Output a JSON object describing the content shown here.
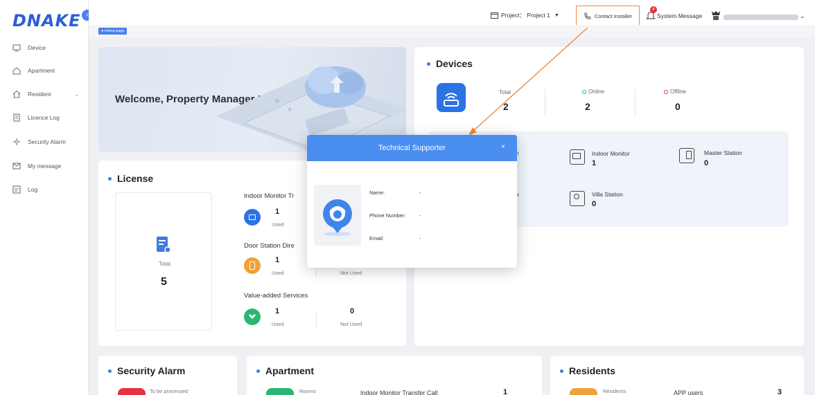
{
  "app": {
    "logo": "DNAKE"
  },
  "sidebar": {
    "items": [
      {
        "label": "Device",
        "icon": "device-icon"
      },
      {
        "label": "Apartment",
        "icon": "apartment-icon"
      },
      {
        "label": "Resident",
        "icon": "resident-icon",
        "expandable": true
      },
      {
        "label": "Licence Log",
        "icon": "licence-log-icon"
      },
      {
        "label": "Security Alarm",
        "icon": "security-alarm-icon"
      },
      {
        "label": "My message",
        "icon": "message-icon"
      },
      {
        "label": "Log",
        "icon": "log-icon"
      }
    ]
  },
  "header": {
    "project_label": "Project： Project 1",
    "contact_label": "Contact Installer",
    "system_message_label": "System Message",
    "message_badge": "4"
  },
  "breadcrumb": {
    "label": "Home page"
  },
  "welcome": {
    "text": "Welcome, Property Manager !"
  },
  "devices": {
    "title": "Devices",
    "total_label": "Total",
    "total": "2",
    "online_label": "Online",
    "online": "2",
    "offline_label": "Offline",
    "offline": "0",
    "types": [
      {
        "label": "Indoor Monitor",
        "value": "1"
      },
      {
        "label": "Master Station",
        "value": "0"
      },
      {
        "label": "Villa Station",
        "value": "0"
      }
    ],
    "partial_labels": [
      "n",
      "n"
    ]
  },
  "license": {
    "title": "License",
    "total_label": "Total",
    "total": "5",
    "groups": [
      {
        "label": "Indoor Monitor Tr",
        "used": "1",
        "used_label": "Used"
      },
      {
        "label": "Door Station Dire",
        "used": "1",
        "used_label": "Used",
        "not_used_label": "Not Used"
      },
      {
        "label": "Value-added Services",
        "used": "1",
        "used_label": "Used",
        "not_used": "0",
        "not_used_label": "Not Used"
      }
    ]
  },
  "modal": {
    "title": "Technical Supporter",
    "close": "×",
    "fields": [
      {
        "label": "Name:",
        "value": "-"
      },
      {
        "label": "Phone Number:",
        "value": "-"
      },
      {
        "label": "Email:",
        "value": "-"
      }
    ]
  },
  "bottom": {
    "security_alarm": {
      "title": "Security Alarm",
      "sub": "To be processed"
    },
    "apartment": {
      "title": "Apartment",
      "rooms_label": "Rooms",
      "transfer_label": "Indoor Monitor Transfer Call",
      "transfer_value": "1"
    },
    "residents": {
      "title": "Residents",
      "residents_label": "Residents",
      "app_users_label": "APP users",
      "app_users_value": "3"
    }
  },
  "colors": {
    "accent": "#4a8ef0",
    "highlight": "#f08a3c",
    "online": "#2bb673",
    "offline": "#e5323e"
  }
}
